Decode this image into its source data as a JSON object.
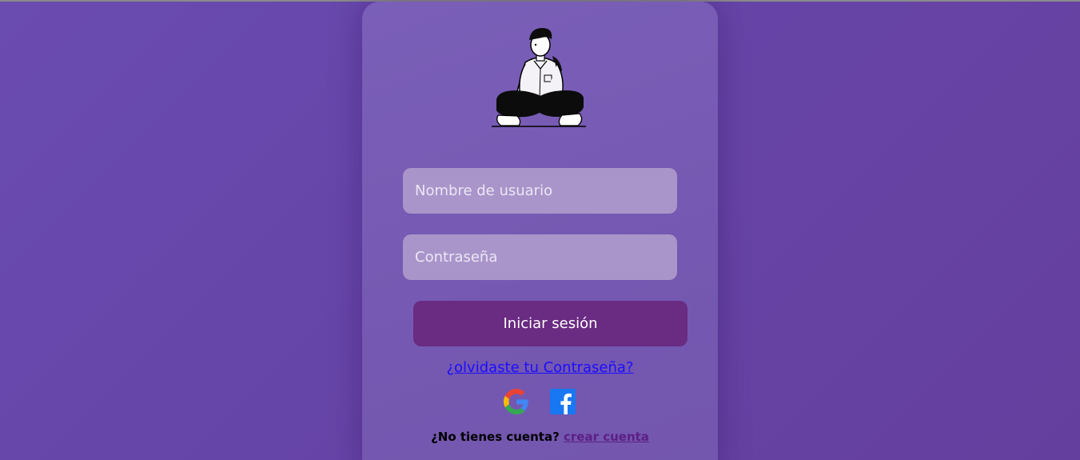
{
  "login": {
    "username_placeholder": "Nombre de usuario",
    "password_placeholder": "Contraseña",
    "submit_label": "Iniciar sesión",
    "forgot_label": "¿olvidaste tu Contraseña?",
    "social": [
      {
        "name": "google",
        "icon": "google-icon"
      },
      {
        "name": "facebook",
        "icon": "facebook-icon"
      }
    ],
    "no_account_text": "¿No tienes cuenta?",
    "create_account_label": "crear cuenta"
  },
  "colors": {
    "background": "#6645a8",
    "card": "#7558b1",
    "input": "#a995ca",
    "button": "#6a2b82",
    "link": "#1a0dff",
    "create_link": "#5b1f86"
  }
}
